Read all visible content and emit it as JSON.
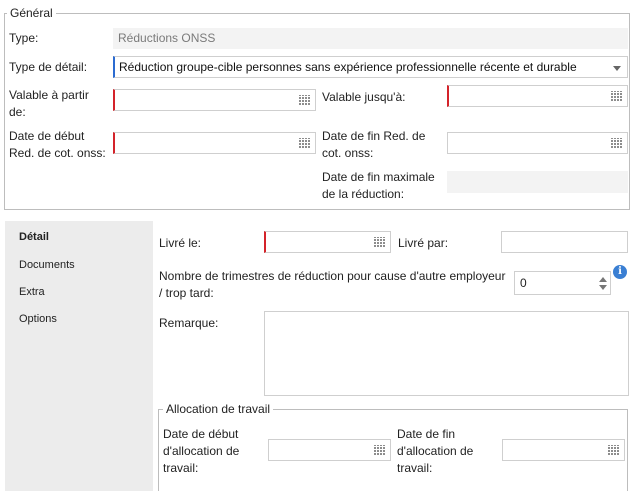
{
  "general": {
    "legend": "Général",
    "type_label": "Type:",
    "type_value": "Réductions ONSS",
    "detail_type_label": "Type de détail:",
    "detail_type_value": "Réduction groupe-cible personnes sans expérience professionnelle récente et durable",
    "valid_from_label_1": "Valable à partir",
    "valid_from_label_2": "de:",
    "valid_until_label": "Valable jusqu'à:",
    "start_red_label_1": "Date de début",
    "start_red_label_2": "Red. de cot. onss:",
    "end_red_label_1": "Date de fin Red. de",
    "end_red_label_2": "cot. onss:",
    "max_end_label_1": "Date de fin maximale",
    "max_end_label_2": "de la réduction:",
    "max_end_value": ""
  },
  "tabs": [
    {
      "label": "Détail",
      "active": true
    },
    {
      "label": "Documents",
      "active": false
    },
    {
      "label": "Extra",
      "active": false
    },
    {
      "label": "Options",
      "active": false
    }
  ],
  "detail": {
    "delivered_on_label": "Livré le:",
    "delivered_by_label": "Livré par:",
    "quarters_label_1": "Nombre de trimestres de réduction pour cause d'autre employeur",
    "quarters_label_2": "/ trop tard:",
    "quarters_value": "0",
    "remark_label": "Remarque:"
  },
  "allocation": {
    "legend": "Allocation de travail",
    "start_label_1": "Date de début",
    "start_label_2": "d'allocation de",
    "start_label_3": "travail:",
    "end_label_1": "Date de fin",
    "end_label_2": "d'allocation de",
    "end_label_3": "travail:"
  },
  "icons": {
    "calendar": "calendar-icon",
    "dropdown": "chevron-down-icon",
    "info": "info-icon",
    "spinner": "spinner-arrows-icon"
  },
  "colors": {
    "required_marker": "#d4232a",
    "focus_marker": "#2b6bd1",
    "info_icon": "#3a7fd3"
  }
}
